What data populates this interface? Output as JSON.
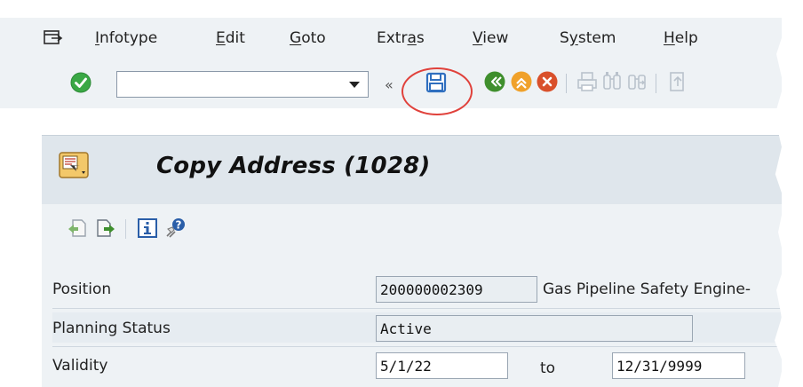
{
  "menubar": {
    "items": [
      {
        "pre": "",
        "accel": "I",
        "post": "nfotype"
      },
      {
        "pre": "",
        "accel": "E",
        "post": "dit"
      },
      {
        "pre": "",
        "accel": "G",
        "post": "oto"
      },
      {
        "pre": "Extr",
        "accel": "a",
        "post": "s"
      },
      {
        "pre": "",
        "accel": "V",
        "post": "iew"
      },
      {
        "pre": "S",
        "accel": "y",
        "post": "stem"
      },
      {
        "pre": "",
        "accel": "H",
        "post": "elp"
      }
    ]
  },
  "toolbar": {
    "command_field_value": "",
    "icons": [
      "enter-icon",
      "save-icon",
      "back-icon",
      "exit-icon",
      "cancel-icon",
      "print-icon",
      "find-icon",
      "find-next-icon",
      "first-page-icon"
    ],
    "highlighted": "save-icon",
    "highlight_color": "#e0413b"
  },
  "screen": {
    "title": "Copy Address (1028)"
  },
  "app_toolbar": {
    "icons": [
      "previous-record-icon",
      "next-record-icon",
      "info-icon",
      "help-icon"
    ]
  },
  "form": {
    "position": {
      "label": "Position",
      "value": "200000002309",
      "description": "Gas Pipeline Safety Engine-"
    },
    "planning_status": {
      "label": "Planning Status",
      "value": "Active"
    },
    "validity": {
      "label": "Validity",
      "from": "5/1/22",
      "to_label": "to",
      "to": "12/31/9999"
    }
  },
  "colors": {
    "background": "#eef2f5",
    "title_panel": "#dfe6ec",
    "enter_green": "#3aa845",
    "back_green": "#3f8f2d",
    "exit_orange": "#f0a12a",
    "cancel_red": "#d9502b"
  }
}
